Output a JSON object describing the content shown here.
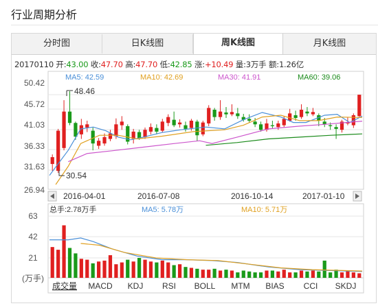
{
  "title": "行业周期分析",
  "tabs": [
    {
      "label": "分时图",
      "active": false
    },
    {
      "label": "日K线图",
      "active": false
    },
    {
      "label": "周K线图",
      "active": true
    },
    {
      "label": "月K线图",
      "active": false
    }
  ],
  "info": {
    "date": "20170110",
    "open_label": "开:",
    "open": "43.00",
    "close_label": "收:",
    "close": "47.70",
    "high_label": "高:",
    "high": "47.70",
    "low_label": "低:",
    "low": "42.85",
    "change_label": "涨:",
    "change": "+10.49",
    "volume_label": "量:",
    "volume": "3万手",
    "amount_label": "额:",
    "amount": "1.26亿"
  },
  "ma_legend": [
    {
      "label": "MA5: 42.59",
      "color": "#4a8fd8"
    },
    {
      "label": "MA10: 42.69",
      "color": "#e0a020"
    },
    {
      "label": "MA30: 41.91",
      "color": "#cc55cc"
    },
    {
      "label": "MA60: 39.06",
      "color": "#1a8a1a"
    }
  ],
  "colors": {
    "up": "#e02020",
    "down": "#1a9a1a",
    "ma5": "#4a8fd8",
    "ma10": "#e0a020",
    "ma30": "#cc55cc",
    "ma60": "#1a8a1a"
  },
  "price_axis": {
    "ticks": [
      "50.42",
      "45.72",
      "41.03",
      "36.33",
      "31.63",
      "26.94"
    ]
  },
  "annotations": {
    "high": "48.46",
    "low": "30.54"
  },
  "date_axis": [
    "2016-04-01",
    "2016-07-08",
    "2016-10-14",
    "2017-01-10"
  ],
  "volume_legend": [
    {
      "label": "总手:2.78万手",
      "color": "#333333"
    },
    {
      "label": "MA5: 5.78万",
      "color": "#4a8fd8"
    },
    {
      "label": "MA10: 5.71万",
      "color": "#e0a020"
    }
  ],
  "volume_axis": {
    "ticks": [
      "63",
      "42",
      "21"
    ],
    "unit": "(万手)"
  },
  "indicators": [
    "成交量",
    "MACD",
    "KDJ",
    "RSI",
    "BOLL",
    "MTM",
    "BIAS",
    "CCI",
    "SKDJ"
  ],
  "active_indicator": "成交量",
  "chart_data": {
    "type": "candlestick",
    "ylim": [
      26.94,
      50.42
    ],
    "candles": [
      {
        "o": 32.5,
        "c": 34.0,
        "h": 34.6,
        "l": 31.0
      },
      {
        "o": 31.0,
        "c": 39.8,
        "h": 40.2,
        "l": 30.54
      },
      {
        "o": 36.0,
        "c": 44.0,
        "h": 46.5,
        "l": 35.5
      },
      {
        "o": 44.0,
        "c": 41.5,
        "h": 48.46,
        "l": 41.0
      },
      {
        "o": 41.5,
        "c": 38.5,
        "h": 41.8,
        "l": 37.8
      },
      {
        "o": 39.0,
        "c": 41.0,
        "h": 42.4,
        "l": 38.0
      },
      {
        "o": 40.5,
        "c": 41.2,
        "h": 42.0,
        "l": 39.5
      },
      {
        "o": 39.8,
        "c": 37.0,
        "h": 40.5,
        "l": 35.5
      },
      {
        "o": 36.5,
        "c": 37.6,
        "h": 38.2,
        "l": 35.8
      },
      {
        "o": 37.0,
        "c": 38.4,
        "h": 39.2,
        "l": 36.5
      },
      {
        "o": 38.0,
        "c": 39.2,
        "h": 40.0,
        "l": 37.5
      },
      {
        "o": 38.6,
        "c": 41.2,
        "h": 42.5,
        "l": 38.0
      },
      {
        "o": 41.0,
        "c": 41.8,
        "h": 43.0,
        "l": 40.0
      },
      {
        "o": 40.8,
        "c": 37.4,
        "h": 41.2,
        "l": 36.8
      },
      {
        "o": 38.0,
        "c": 39.6,
        "h": 40.2,
        "l": 37.0
      },
      {
        "o": 39.5,
        "c": 38.2,
        "h": 40.0,
        "l": 37.8
      },
      {
        "o": 38.4,
        "c": 40.0,
        "h": 40.5,
        "l": 38.0
      },
      {
        "o": 39.6,
        "c": 40.6,
        "h": 41.4,
        "l": 39.0
      },
      {
        "o": 40.4,
        "c": 39.6,
        "h": 41.2,
        "l": 39.0
      },
      {
        "o": 39.8,
        "c": 41.8,
        "h": 42.4,
        "l": 39.5
      },
      {
        "o": 41.5,
        "c": 42.8,
        "h": 43.4,
        "l": 40.8
      },
      {
        "o": 42.2,
        "c": 41.0,
        "h": 44.0,
        "l": 40.6
      },
      {
        "o": 41.2,
        "c": 41.6,
        "h": 42.3,
        "l": 40.5
      },
      {
        "o": 41.0,
        "c": 40.2,
        "h": 41.8,
        "l": 39.6
      },
      {
        "o": 40.4,
        "c": 42.0,
        "h": 42.4,
        "l": 39.8
      },
      {
        "o": 41.8,
        "c": 38.8,
        "h": 42.2,
        "l": 37.6
      },
      {
        "o": 39.0,
        "c": 41.6,
        "h": 42.0,
        "l": 38.6
      },
      {
        "o": 41.4,
        "c": 44.8,
        "h": 45.4,
        "l": 40.8
      },
      {
        "o": 44.4,
        "c": 42.8,
        "h": 44.8,
        "l": 42.0
      },
      {
        "o": 42.8,
        "c": 44.0,
        "h": 46.5,
        "l": 42.2
      },
      {
        "o": 43.8,
        "c": 43.4,
        "h": 45.0,
        "l": 42.6
      },
      {
        "o": 43.4,
        "c": 43.9,
        "h": 45.6,
        "l": 43.0
      },
      {
        "o": 43.6,
        "c": 43.0,
        "h": 44.8,
        "l": 42.4
      },
      {
        "o": 42.8,
        "c": 42.2,
        "h": 43.5,
        "l": 41.8
      },
      {
        "o": 42.4,
        "c": 42.0,
        "h": 43.4,
        "l": 41.6
      },
      {
        "o": 41.8,
        "c": 41.2,
        "h": 42.6,
        "l": 40.6
      },
      {
        "o": 41.2,
        "c": 40.0,
        "h": 41.8,
        "l": 39.6
      },
      {
        "o": 40.0,
        "c": 41.4,
        "h": 42.4,
        "l": 39.6
      },
      {
        "o": 41.0,
        "c": 40.8,
        "h": 42.0,
        "l": 40.2
      },
      {
        "o": 40.6,
        "c": 41.4,
        "h": 42.0,
        "l": 40.0
      },
      {
        "o": 41.0,
        "c": 42.4,
        "h": 43.0,
        "l": 40.6
      },
      {
        "o": 42.0,
        "c": 43.6,
        "h": 44.6,
        "l": 41.8
      },
      {
        "o": 43.2,
        "c": 42.6,
        "h": 44.2,
        "l": 42.0
      },
      {
        "o": 42.8,
        "c": 44.4,
        "h": 45.6,
        "l": 42.4
      },
      {
        "o": 44.0,
        "c": 43.6,
        "h": 45.0,
        "l": 43.0
      },
      {
        "o": 43.4,
        "c": 43.9,
        "h": 44.8,
        "l": 43.0
      },
      {
        "o": 43.2,
        "c": 42.0,
        "h": 43.6,
        "l": 40.8
      },
      {
        "o": 41.8,
        "c": 41.2,
        "h": 42.6,
        "l": 40.6
      },
      {
        "o": 41.0,
        "c": 40.8,
        "h": 41.6,
        "l": 40.0
      },
      {
        "o": 40.6,
        "c": 40.2,
        "h": 41.2,
        "l": 38.0
      },
      {
        "o": 40.0,
        "c": 41.8,
        "h": 42.2,
        "l": 39.4
      },
      {
        "o": 41.4,
        "c": 41.6,
        "h": 42.8,
        "l": 41.0
      },
      {
        "o": 41.0,
        "c": 43.2,
        "h": 43.6,
        "l": 40.4
      },
      {
        "o": 43.0,
        "c": 47.7,
        "h": 47.7,
        "l": 42.85
      }
    ],
    "ma": {
      "ma5": [
        [
          0,
          30.0
        ],
        [
          0.06,
          35.5
        ],
        [
          0.1,
          40.2
        ],
        [
          0.14,
          40.6
        ],
        [
          0.18,
          39.8
        ],
        [
          0.22,
          38.4
        ],
        [
          0.26,
          37.8
        ],
        [
          0.3,
          38.4
        ],
        [
          0.36,
          39.4
        ],
        [
          0.42,
          40.0
        ],
        [
          0.5,
          40.6
        ],
        [
          0.56,
          40.2
        ],
        [
          0.62,
          42.2
        ],
        [
          0.68,
          43.8
        ],
        [
          0.74,
          42.8
        ],
        [
          0.78,
          41.6
        ],
        [
          0.82,
          41.6
        ],
        [
          0.88,
          43.2
        ],
        [
          0.92,
          43.4
        ],
        [
          0.96,
          41.6
        ],
        [
          1.0,
          43.0
        ]
      ],
      "ma10": [
        [
          0.02,
          28.0
        ],
        [
          0.06,
          32.0
        ],
        [
          0.1,
          37.0
        ],
        [
          0.16,
          38.8
        ],
        [
          0.22,
          38.8
        ],
        [
          0.28,
          38.0
        ],
        [
          0.36,
          38.6
        ],
        [
          0.46,
          39.6
        ],
        [
          0.56,
          40.0
        ],
        [
          0.62,
          41.0
        ],
        [
          0.68,
          42.8
        ],
        [
          0.74,
          43.2
        ],
        [
          0.8,
          42.0
        ],
        [
          0.86,
          42.0
        ],
        [
          0.92,
          42.8
        ],
        [
          1.0,
          42.7
        ]
      ],
      "ma30": [
        [
          0.06,
          33.0
        ],
        [
          0.12,
          34.8
        ],
        [
          0.2,
          35.4
        ],
        [
          0.3,
          36.2
        ],
        [
          0.4,
          37.0
        ],
        [
          0.48,
          37.6
        ],
        [
          0.52,
          37.0
        ],
        [
          0.6,
          38.4
        ],
        [
          0.7,
          40.2
        ],
        [
          0.8,
          40.8
        ],
        [
          0.88,
          41.2
        ],
        [
          1.0,
          41.9
        ]
      ],
      "ma60": [
        [
          0.5,
          36.6
        ],
        [
          0.6,
          37.2
        ],
        [
          0.7,
          38.0
        ],
        [
          0.8,
          38.4
        ],
        [
          0.9,
          38.8
        ],
        [
          1.0,
          39.1
        ]
      ]
    },
    "volume": {
      "ylim": [
        0,
        72
      ],
      "bars": [
        34,
        31,
        58,
        33,
        27,
        21,
        20,
        16,
        18,
        19,
        25,
        15,
        17,
        20,
        18,
        22,
        20,
        18,
        17,
        19,
        17,
        14,
        15,
        12,
        11,
        10,
        9,
        9,
        10,
        8,
        9,
        8,
        6,
        8,
        7,
        6,
        6,
        8,
        8,
        7,
        9,
        6,
        6,
        8,
        7,
        8,
        7,
        19,
        6,
        9,
        6,
        8,
        6,
        5
      ],
      "ma5": [
        [
          0,
          42
        ],
        [
          0.06,
          42
        ],
        [
          0.1,
          44
        ],
        [
          0.14,
          40
        ],
        [
          0.2,
          32
        ],
        [
          0.28,
          24
        ],
        [
          0.36,
          20
        ],
        [
          0.44,
          20
        ],
        [
          0.52,
          19
        ],
        [
          0.6,
          17
        ],
        [
          0.7,
          12
        ],
        [
          0.8,
          9
        ],
        [
          0.9,
          8
        ],
        [
          1.0,
          7
        ]
      ],
      "ma10": [
        [
          0.1,
          38
        ],
        [
          0.16,
          36
        ],
        [
          0.24,
          28
        ],
        [
          0.34,
          22
        ],
        [
          0.44,
          20
        ],
        [
          0.54,
          19
        ],
        [
          0.64,
          15
        ],
        [
          0.74,
          11
        ],
        [
          0.84,
          9
        ],
        [
          0.94,
          8
        ],
        [
          1.0,
          7.5
        ]
      ]
    }
  }
}
